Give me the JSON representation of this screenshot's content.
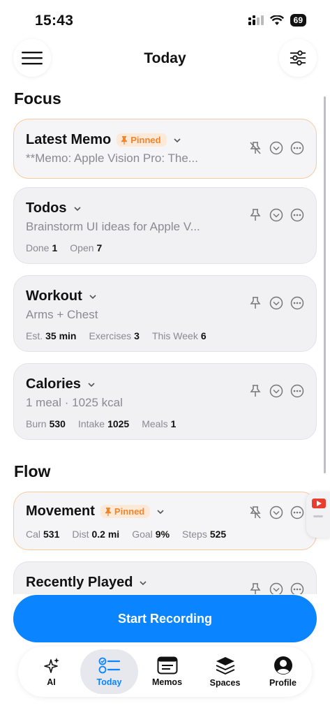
{
  "status": {
    "time": "15:43",
    "battery": "69"
  },
  "header": {
    "title": "Today"
  },
  "sections": {
    "focus": "Focus",
    "flow": "Flow"
  },
  "pinned_label": "Pinned",
  "cards": {
    "latest_memo": {
      "title": "Latest Memo",
      "subtitle": "**Memo: Apple Vision Pro: The..."
    },
    "todos": {
      "title": "Todos",
      "subtitle": "Brainstorm UI ideas for Apple V...",
      "stats": [
        {
          "label": "Done",
          "value": "1"
        },
        {
          "label": "Open",
          "value": "7"
        }
      ]
    },
    "workout": {
      "title": "Workout",
      "subtitle": "Arms + Chest",
      "stats": [
        {
          "label": "Est.",
          "value": "35 min"
        },
        {
          "label": "Exercises",
          "value": "3"
        },
        {
          "label": "This Week",
          "value": "6"
        }
      ]
    },
    "calories": {
      "title": "Calories",
      "subtitle": "1 meal · 1025 kcal",
      "stats": [
        {
          "label": "Burn",
          "value": "530"
        },
        {
          "label": "Intake",
          "value": "1025"
        },
        {
          "label": "Meals",
          "value": "1"
        }
      ]
    },
    "movement": {
      "title": "Movement",
      "stats": [
        {
          "label": "Cal",
          "value": "531"
        },
        {
          "label": "Dist",
          "value": "0.2 mi"
        },
        {
          "label": "Goal",
          "value": "9%"
        },
        {
          "label": "Steps",
          "value": "525"
        }
      ]
    },
    "recently_played": {
      "title": "Recently Played"
    }
  },
  "record_button": "Start Recording",
  "tabs": [
    {
      "label": "AI",
      "icon": "sparkles-icon"
    },
    {
      "label": "Today",
      "icon": "checklist-icon"
    },
    {
      "label": "Memos",
      "icon": "memo-icon"
    },
    {
      "label": "Spaces",
      "icon": "layers-icon"
    },
    {
      "label": "Profile",
      "icon": "profile-icon"
    }
  ],
  "colors": {
    "accent": "#0a84ff",
    "pinned": "#f0852e",
    "pinned_border": "#f7c9a1"
  }
}
